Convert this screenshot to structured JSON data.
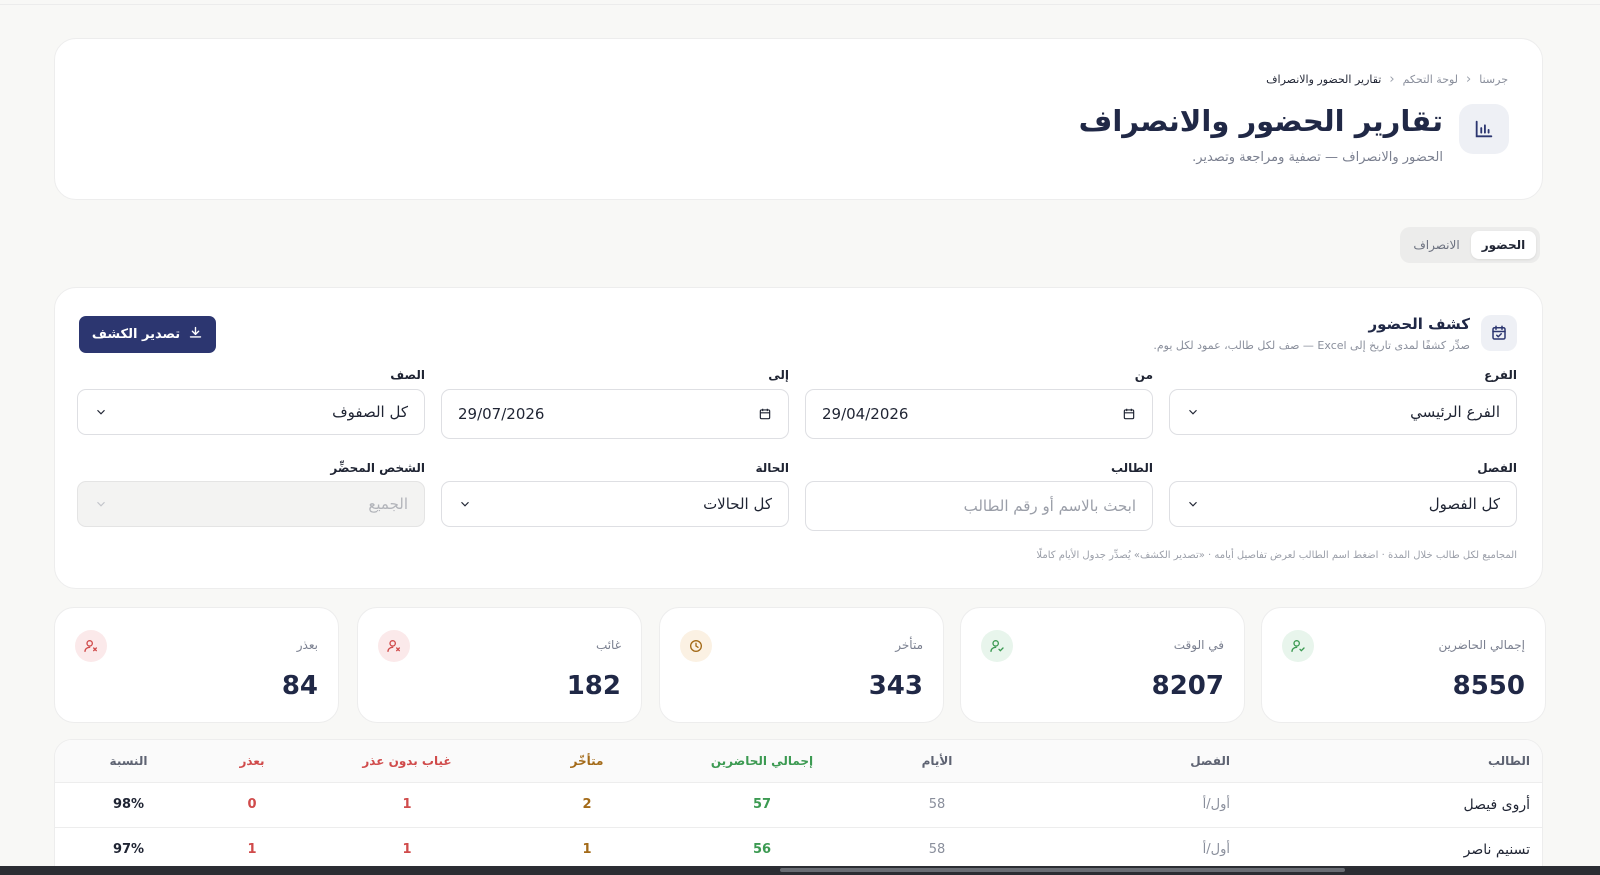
{
  "header": {
    "breadcrumb": [
      "جرسنا",
      "لوحة التحكم",
      "تقارير الحضور والانصراف"
    ],
    "title": "تقارير الحضور والانصراف",
    "subtitle": "الحضور والانصراف — تصفية ومراجعة وتصدير."
  },
  "tabs": [
    {
      "label": "الحضور",
      "active": true
    },
    {
      "label": "الانصراف",
      "active": false
    }
  ],
  "section": {
    "title": "كشف الحضور",
    "subtitle": "صدِّر كشفًا لمدى تاريخ إلى Excel — صف لكل طالب، عمود لكل يوم.",
    "export_label": "تصدير الكشف"
  },
  "filters": {
    "branch": {
      "label": "الفرع",
      "value": "الفرع الرئيسي"
    },
    "from": {
      "label": "من",
      "value": "29/04/2026"
    },
    "to": {
      "label": "إلى",
      "value": "29/07/2026"
    },
    "grade": {
      "label": "الصف",
      "value": "كل الصفوف"
    },
    "classroom": {
      "label": "الفصل",
      "value": "كل الفصول"
    },
    "student": {
      "label": "الطالب",
      "placeholder": "ابحث بالاسم أو رقم الطالب"
    },
    "status": {
      "label": "الحالة",
      "value": "كل الحالات"
    },
    "recorder": {
      "label": "الشخص المحضِّر",
      "value": "الجميع"
    },
    "hint": "المجاميع لكل طالب خلال المدة · اضغط اسم الطالب لعرض تفاصيل أيامه · «تصدير الكشف» يُصدِّر جدول الأيام كاملًا"
  },
  "stats": [
    {
      "label": "إجمالي الحاضرين",
      "value": "8550",
      "icon": "user-check-icon",
      "color": "#3c9a52"
    },
    {
      "label": "في الوقت",
      "value": "8207",
      "icon": "user-check-icon",
      "color": "#3c9a52"
    },
    {
      "label": "متأخر",
      "value": "343",
      "icon": "clock-icon",
      "color": "#a36a18"
    },
    {
      "label": "غائب",
      "value": "182",
      "icon": "user-x-icon",
      "color": "#d04b4b"
    },
    {
      "label": "بعذر",
      "value": "84",
      "icon": "user-x-icon",
      "color": "#d04b4b"
    }
  ],
  "table": {
    "headers": {
      "student": "الطالب",
      "classroom": "الفصل",
      "days": "الأيام",
      "present": "إجمالي الحاضرين",
      "late": "متأخّر",
      "absent": "غياب بدون عذر",
      "excused": "بعذر",
      "rate": "النسبة"
    },
    "rows": [
      {
        "student": "أروى فيصل",
        "classroom": "أول/أ",
        "days": "58",
        "present": "57",
        "late": "2",
        "absent": "1",
        "excused": "0",
        "rate": "98%"
      },
      {
        "student": "تسنيم ناصر",
        "classroom": "أول/أ",
        "days": "58",
        "present": "56",
        "late": "1",
        "absent": "1",
        "excused": "1",
        "rate": "97%"
      }
    ]
  }
}
